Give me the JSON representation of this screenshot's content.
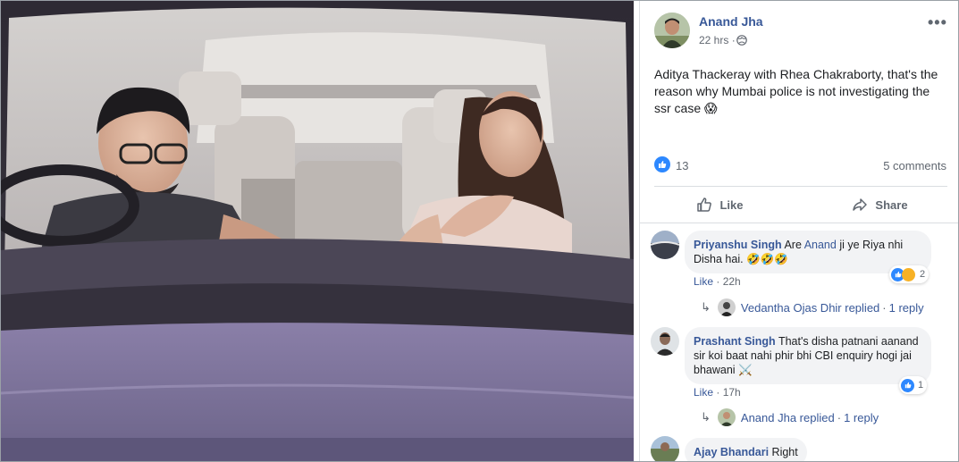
{
  "post": {
    "author": "Anand Jha",
    "time": "22 hrs",
    "text": "Aditya Thackeray with Rhea Chakraborty, that's the reason why Mumbai police is not investigating the ssr case",
    "text_emoji": "😱",
    "reaction_count": "13",
    "comments_label": "5 comments",
    "like_label": "Like",
    "share_label": "Share",
    "more_icon": "more-options-icon",
    "privacy_icon": "globe-icon",
    "like_color": "#2d88ff",
    "link_color": "#385898"
  },
  "comments": [
    {
      "author": "Priyanshu Singh",
      "text_before": "Are ",
      "mention": "Anand",
      "text_after": " ji ye Riya nhi Disha hai.",
      "emojis": "🤣🤣🤣",
      "like_label": "Like",
      "time": "22h",
      "reaction_count": "2",
      "reply_author": "Vedantha Ojas Dhir replied",
      "reply_count": "1 reply"
    },
    {
      "author": "Prashant Singh",
      "text": "That's disha patnani aanand sir koi baat nahi phir bhi CBI enquiry hogi jai bhawani",
      "emojis": "⚔️",
      "like_label": "Like",
      "time": "17h",
      "reaction_count": "1",
      "reply_author": "Anand Jha replied",
      "reply_count": "1 reply"
    },
    {
      "author": "Ajay Bhandari",
      "text": "Right"
    }
  ],
  "separator": "·"
}
